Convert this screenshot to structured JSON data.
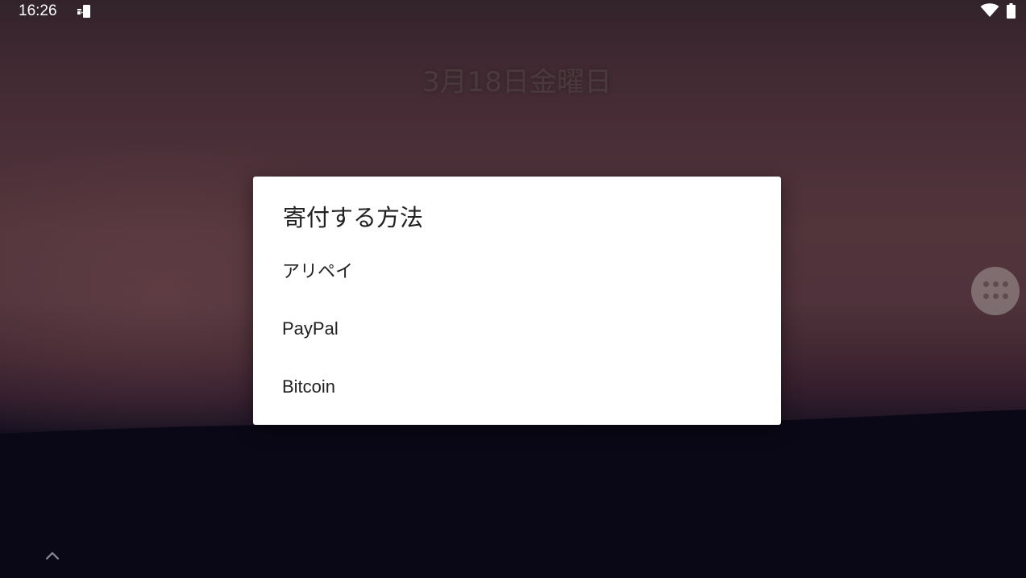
{
  "status_bar": {
    "time": "16:26",
    "notification_icon": "download-notification-icon",
    "wifi_icon": "wifi-icon",
    "battery_icon": "battery-icon"
  },
  "lockscreen": {
    "date": "3月18日金曜日"
  },
  "dialog": {
    "title": "寄付する方法",
    "options": [
      {
        "label": "アリペイ"
      },
      {
        "label": "PayPal"
      },
      {
        "label": "Bitcoin"
      }
    ]
  },
  "side_button": {
    "icon": "apps-grid-icon"
  },
  "bottom": {
    "icon": "chevron-up-icon"
  }
}
